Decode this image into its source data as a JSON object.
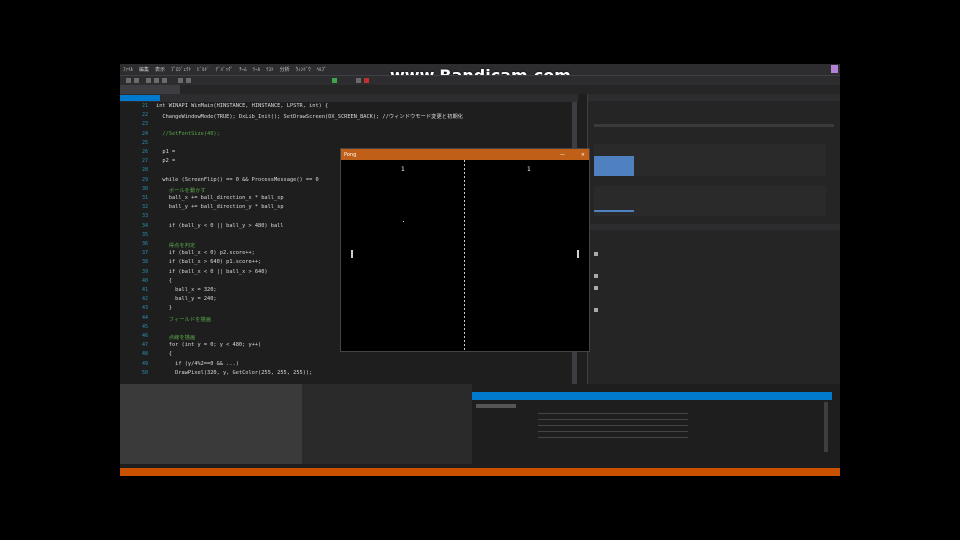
{
  "watermark": "www.Bandicam.com",
  "game_window": {
    "title": "Pong",
    "p1_score": "1",
    "p2_score": "1"
  },
  "editor": {
    "line_numbers": [
      "21",
      "22",
      "23",
      "24",
      "25",
      "26",
      "27",
      "28",
      "29",
      "30",
      "31",
      "32",
      "33",
      "34",
      "35",
      "36",
      "37",
      "38",
      "39",
      "40",
      "41",
      "42",
      "43",
      "44",
      "45",
      "46",
      "47",
      "48",
      "49",
      "50"
    ],
    "code": [
      "int WINAPI WinMain(HINSTANCE, HINSTANCE, LPSTR, int) {",
      "  ChangeWindowMode(TRUE); DxLib_Init(); SetDrawScreen(DX_SCREEN_BACK); //ウィンドウモード変更と初期化",
      "",
      "  //SetFontSize(40);",
      "",
      "  p1 = ",
      "  p2 = ",
      "",
      "  while (ScreenFlip() == 0 && ProcessMessage() == 0",
      "    ボールを動かす",
      "    ball_x += ball_direction_x * ball_sp",
      "    ball_y += ball_direction_y * ball_sp",
      "",
      "    if (ball_y < 0 || ball_y > 480) ball",
      "",
      "    得点を判定",
      "    if (ball_x < 0) p2.score++;",
      "    if (ball_x > 640) p1.score++;",
      "    if (ball_x < 0 || ball_x > 640)",
      "    {",
      "      ball_x = 320;",
      "      ball_y = 240;",
      "    }",
      "    フィールドを描画",
      "",
      "    点線を描画",
      "    for (int y = 0; y < 480; y++)",
      "    {",
      "      if (y/4%2==0 && ...)",
      "      DrawPixel(320, y, GetColor(255, 255, 255));"
    ]
  }
}
